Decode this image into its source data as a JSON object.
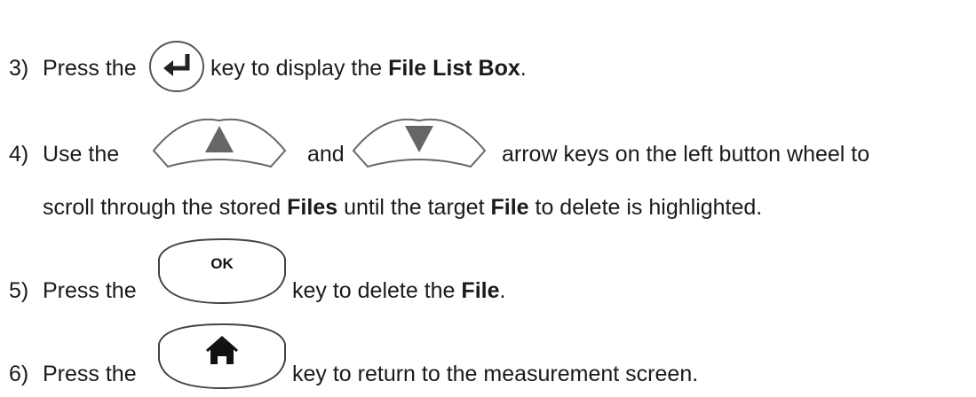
{
  "steps": [
    {
      "number": "3)",
      "pre": "Press the",
      "post": "key to display the",
      "bold": "File List Box",
      "end": "."
    },
    {
      "number": "4)",
      "pre": "Use the",
      "mid": "and",
      "post": "arrow keys on the left button wheel to",
      "cont_pre": "scroll through the stored",
      "cont_bold1": "Files",
      "cont_mid": "until the target",
      "cont_bold2": "File",
      "cont_post": "to delete is highlighted."
    },
    {
      "number": "5)",
      "pre": "Press the",
      "key_label": "OK",
      "post": "key to delete the",
      "bold": "File",
      "end": "."
    },
    {
      "number": "6)",
      "pre": "Press the",
      "post": "key to return to the measurement screen."
    }
  ],
  "icons": {
    "enter_key": "enter-key-icon",
    "up_key": "up-arrow-key-icon",
    "down_key": "down-arrow-key-icon",
    "ok_key": "ok-key-icon",
    "home_key": "home-key-icon"
  },
  "colors": {
    "text": "#1a1a1a",
    "key_outline": "#555555",
    "arrow_fill": "#666666"
  }
}
